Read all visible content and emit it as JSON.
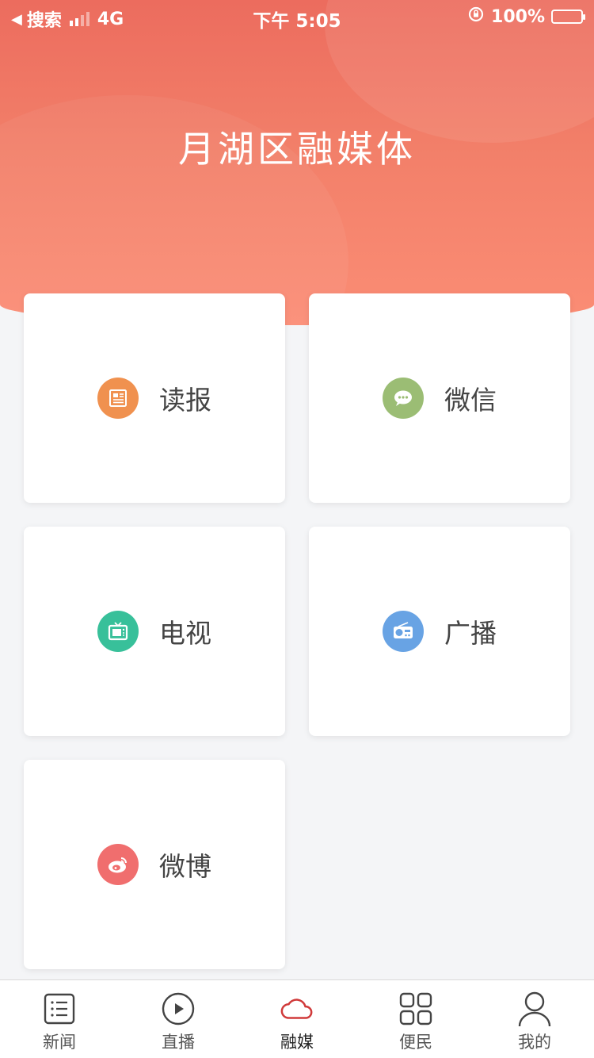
{
  "status_bar": {
    "back_label": "搜索",
    "network": "4G",
    "time": "下午 5:05",
    "battery": "100%"
  },
  "header": {
    "title": "月湖区融媒体"
  },
  "cards": [
    {
      "label": "读报",
      "icon": "newspaper-icon",
      "color": "#f0914f"
    },
    {
      "label": "微信",
      "icon": "wechat-icon",
      "color": "#9bbd74"
    },
    {
      "label": "电视",
      "icon": "tv-icon",
      "color": "#38c09a"
    },
    {
      "label": "广播",
      "icon": "radio-icon",
      "color": "#68a3e4"
    },
    {
      "label": "微博",
      "icon": "weibo-icon",
      "color": "#f06e6e"
    }
  ],
  "tabbar": {
    "tabs": [
      {
        "label": "新闻",
        "icon": "list-icon"
      },
      {
        "label": "直播",
        "icon": "play-icon"
      },
      {
        "label": "融媒",
        "icon": "cloud-icon",
        "active": true
      },
      {
        "label": "便民",
        "icon": "grid-icon"
      },
      {
        "label": "我的",
        "icon": "user-icon"
      }
    ]
  },
  "colors": {
    "header_start": "#ec6c5e",
    "header_end": "#fb8d75",
    "active_tab": "#d03a3a"
  }
}
